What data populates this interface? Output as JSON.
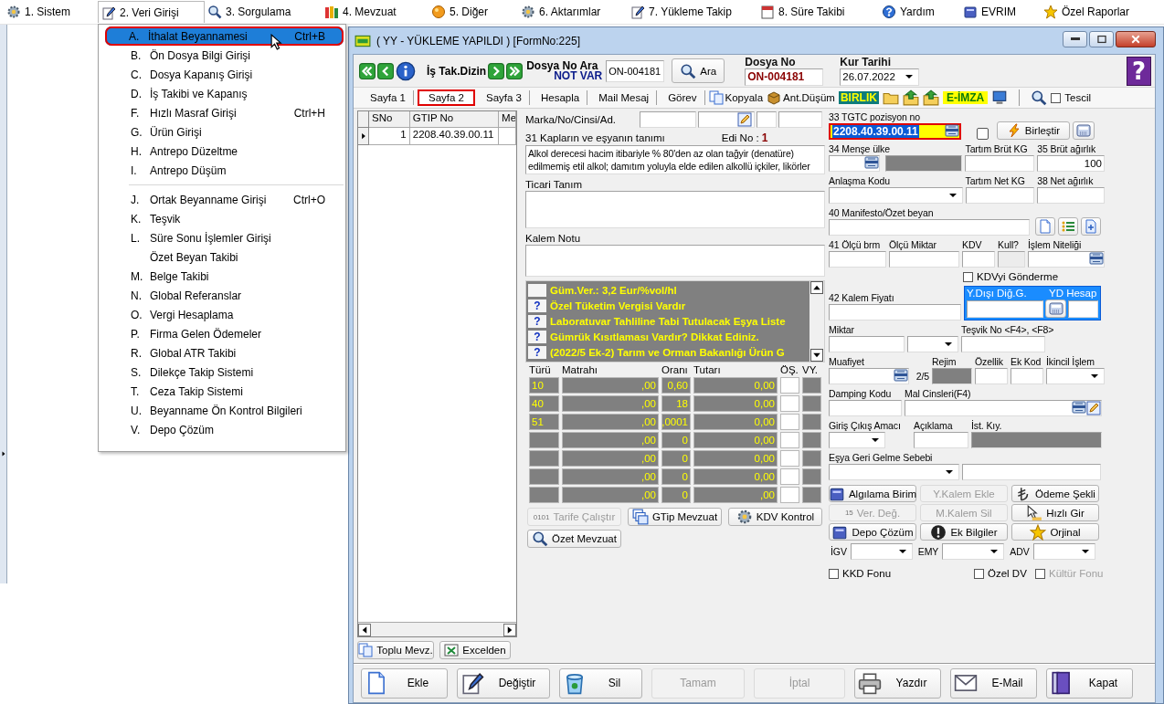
{
  "menu_bar": {
    "items": [
      {
        "label": "1.  Sistem",
        "selected": false
      },
      {
        "label": "2. Veri Girişi",
        "selected": true
      },
      {
        "label": "3.  Sorgulama",
        "selected": false
      },
      {
        "label": "4.  Mevzuat",
        "selected": false
      },
      {
        "label": "5.  Diğer",
        "selected": false
      },
      {
        "label": "6.  Aktarımlar",
        "selected": false
      },
      {
        "label": "7.  Yükleme Takip",
        "selected": false
      },
      {
        "label": "8. Süre Takibi",
        "selected": false
      },
      {
        "label": "Yardım",
        "selected": false
      },
      {
        "label": "EVRIM",
        "selected": false
      },
      {
        "label": "Özel Raporlar",
        "selected": false
      }
    ]
  },
  "dropdown": {
    "items": [
      {
        "kind": "item",
        "key": "A.",
        "label": "İthalat Beyannamesi",
        "shortcut": "Ctrl+B",
        "selected": true
      },
      {
        "kind": "item",
        "key": "B.",
        "label": "Ön Dosya Bilgi Girişi",
        "selected": false
      },
      {
        "kind": "item",
        "key": "C.",
        "label": "Dosya Kapanış Girişi",
        "selected": false
      },
      {
        "kind": "item",
        "key": "D.",
        "label": "İş Takibi ve Kapanış",
        "selected": false
      },
      {
        "kind": "item",
        "key": "F.",
        "label": "Hızlı Masraf Girişi",
        "shortcut": "Ctrl+H",
        "selected": false
      },
      {
        "kind": "item",
        "key": "G.",
        "label": "Ürün Girişi",
        "selected": false
      },
      {
        "kind": "item",
        "key": "H.",
        "label": "Antrepo Düzeltme",
        "selected": false
      },
      {
        "kind": "item",
        "key": "I.",
        "label": "Antrepo Düşüm",
        "selected": false
      },
      {
        "kind": "separator"
      },
      {
        "kind": "item",
        "key": "J.",
        "label": "Ortak Beyanname Girişi",
        "shortcut": "Ctrl+O",
        "selected": false
      },
      {
        "kind": "item",
        "key": "K.",
        "label": "Teşvik",
        "selected": false
      },
      {
        "kind": "item",
        "key": "L.",
        "label": "Süre Sonu İşlemler Girişi",
        "selected": false
      },
      {
        "kind": "item",
        "label": "Özet Beyan Takibi",
        "selected": false
      },
      {
        "kind": "item",
        "key": "M.",
        "label": "Belge Takibi",
        "selected": false
      },
      {
        "kind": "item",
        "key": "N.",
        "label": "Global Referanslar",
        "selected": false
      },
      {
        "kind": "item",
        "key": "O.",
        "label": "Vergi Hesaplama",
        "selected": false
      },
      {
        "kind": "item",
        "key": "P.",
        "label": "Firma Gelen Ödemeler",
        "selected": false
      },
      {
        "kind": "item",
        "key": "R.",
        "label": "Global ATR Takibi",
        "selected": false
      },
      {
        "kind": "item",
        "key": "S.",
        "label": "Dilekçe Takip Sistemi",
        "selected": false
      },
      {
        "kind": "item",
        "key": "T.",
        "label": "Ceza Takip Sistemi",
        "selected": false
      },
      {
        "kind": "item",
        "key": "U.",
        "label": "Beyanname Ön Kontrol Bilgileri",
        "selected": false
      },
      {
        "kind": "item",
        "key": "V.",
        "label": "Depo Çözüm",
        "selected": false
      }
    ]
  },
  "window": {
    "title": "( YY  - YÜKLEME YAPILDI ) [FormNo:225]",
    "help": "?"
  },
  "toolbar": {
    "is_takip_label": "İş Tak.Dizin",
    "dosya_no_ara_label": "Dosya No Ara",
    "not_var": "NOT VAR",
    "search_value": "ON-004181",
    "ara_button": "Ara",
    "dosya_no_label": "Dosya No",
    "dosya_no_value": "ON-004181",
    "kur_tarihi_label": "Kur Tarihi",
    "kur_tarihi_value": "26.07.2022"
  },
  "tabs": [
    {
      "label": "Sayfa 1",
      "selected": false
    },
    {
      "label": "Sayfa 2",
      "selected": true
    },
    {
      "label": "Sayfa 3",
      "selected": false
    },
    {
      "label": "Hesapla",
      "selected": false
    },
    {
      "label": "Mail Mesaj",
      "selected": false
    },
    {
      "label": "Görev",
      "selected": false
    }
  ],
  "tab_tools": {
    "kopyala": "Kopyala",
    "ant_dusum": "Ant.Düşüm",
    "birlik": "BIRLIK",
    "e_imza": "E-İMZA",
    "tescil": {
      "label": "Tescil",
      "checked": false
    }
  },
  "items_grid": {
    "columns": [
      "SNo",
      "GTIP No",
      "Me"
    ],
    "rows": [
      {
        "sno": "1",
        "gtip": "2208.40.39.00.11",
        "selected": true
      }
    ],
    "buttons": [
      "Toplu Mevz.",
      "Excelden"
    ]
  },
  "middle": {
    "marka_label": "Marka/No/Cinsi/Ad.",
    "tanim_label": "31 Kapların ve eşyanın tanımı",
    "edi_label": "Edi No :",
    "edi_value": "1",
    "tanim_value": "Alkol derecesi hacim itibariyle % 80'den az olan tağyir (denatüre) edilmemiş etil alkol; damıtım yoluyla elde edilen alkollü içkiler, likörler",
    "ticari_label": "Ticari Tanım",
    "kalem_notu_label": "Kalem Notu",
    "warnings": [
      {
        "text": "Güm.Ver.: 3,2 Eur/%vol/hl"
      },
      {
        "button": "?",
        "text": "Özel Tüketim Vergisi Vardır"
      },
      {
        "button": "?",
        "text": "Laboratuvar Tahliline Tabi Tutulacak Eşya Liste"
      },
      {
        "button": "?",
        "text": "Gümrük Kısıtlaması Vardır? Dikkat Ediniz."
      },
      {
        "button": "?",
        "text": "(2022/5 Ek-2) Tarım ve Orman Bakanlığı Ürün G"
      }
    ],
    "taxes": {
      "columns": [
        "Türü",
        "Matrahı",
        "Oranı",
        "Tutarı",
        "ÖŞ.",
        "VY."
      ],
      "rows": [
        {
          "turu": "10",
          "matrah": ",00",
          "oran": "0,60",
          "tutar": "0,00"
        },
        {
          "turu": "40",
          "matrah": ",00",
          "oran": "18",
          "tutar": "0,00"
        },
        {
          "turu": "51",
          "matrah": ",00",
          "oran": ",0001",
          "tutar": "0,00"
        },
        {
          "matrah": ",00",
          "oran": "0",
          "tutar": "0,00"
        },
        {
          "matrah": ",00",
          "oran": "0",
          "tutar": "0,00"
        },
        {
          "matrah": ",00",
          "oran": "0",
          "tutar": "0,00"
        },
        {
          "matrah": ",00",
          "oran": "0",
          "tutar": ",00"
        }
      ]
    },
    "buttons": [
      {
        "label": "Tarife Çalıştır",
        "prefix": "0101",
        "disabled": true
      },
      {
        "label": "GTip Mevzuat",
        "disabled": false
      },
      {
        "label": "KDV Kontrol",
        "disabled": false
      },
      {
        "label": "Özet Mevzuat",
        "disabled": false
      }
    ]
  },
  "right": {
    "tgtc": {
      "label": "33 TGTC pozisyon no",
      "value": "2208.40.39.00.11",
      "selected": true
    },
    "birlestir_check": {
      "checked": false
    },
    "birlestir": "Birleştir",
    "mense": "34 Menşe ülke",
    "tartim_brut": "Tartım Brüt KG",
    "brut": {
      "label": "35 Brüt ağırlık",
      "value": "100"
    },
    "anlasma": "Anlaşma Kodu",
    "tartim_net": "Tartım Net KG",
    "net": "38 Net ağırlık",
    "manifesto": "40 Manifesto/Özet beyan",
    "olcu_brm": "41 Ölçü brm",
    "olcu_miktar": "Ölçü Miktar",
    "kdv": "KDV",
    "kull": "Kull?",
    "islem": "İşlem Niteliği",
    "kdv_gonderme": {
      "label": "KDVyi Gönderme",
      "checked": false
    },
    "kalem_fiyati": "42 Kalem Fiyatı",
    "yd_diger": "Y.Dışı Diğ.G.",
    "yd_hesap": "YD Hesap",
    "miktar": "Miktar",
    "tesvik": "Teşvik No <F4>, <F8>",
    "muafiyet": {
      "label": "Muafiyet",
      "counter": "2/5"
    },
    "rejim": "Rejim",
    "ozellik": "Özellik",
    "ek_kod": "Ek Kod",
    "ikincil": "İkincil İşlem",
    "damping": "Damping Kodu",
    "mal_cinsleri": "Mal Cinsleri(F4)",
    "giris_cikis": "Giriş Çıkış Amacı",
    "aciklama": "Açıklama",
    "ist_kiy": "İst. Kıy.",
    "esya_geri": "Eşya Geri Gelme Sebebi",
    "buttons": [
      {
        "label": "Algılama Birim",
        "disabled": false
      },
      {
        "label": "Y.Kalem Ekle",
        "disabled": true
      },
      {
        "label": "Ödeme Şekli",
        "disabled": false
      },
      {
        "label": "Ver. Değ.",
        "prefix": "15",
        "disabled": true
      },
      {
        "label": "M.Kalem Sil",
        "disabled": true
      },
      {
        "label": "Hızlı Gir",
        "disabled": false
      },
      {
        "label": "Depo Çözüm",
        "disabled": false
      },
      {
        "label": "Ek Bilgiler",
        "disabled": false
      },
      {
        "label": "Orjinal",
        "disabled": false
      }
    ],
    "combos": [
      {
        "label": "İGV"
      },
      {
        "label": "EMY"
      },
      {
        "label": "ADV"
      }
    ],
    "checks": [
      {
        "label": "KKD Fonu",
        "checked": false,
        "disabled": false
      },
      {
        "label": "Özel DV",
        "checked": false,
        "disabled": false
      },
      {
        "label": "Kültür Fonu",
        "checked": false,
        "disabled": true
      }
    ]
  },
  "bottom_buttons": [
    {
      "label": "Ekle",
      "disabled": false
    },
    {
      "label": "Değiştir",
      "disabled": false
    },
    {
      "label": "Sil",
      "disabled": false
    },
    {
      "label": "Tamam",
      "disabled": true
    },
    {
      "label": "İptal",
      "disabled": true
    },
    {
      "label": "Yazdır",
      "disabled": false
    },
    {
      "label": "E-Mail",
      "disabled": false
    },
    {
      "label": "Kapat",
      "disabled": false
    }
  ]
}
